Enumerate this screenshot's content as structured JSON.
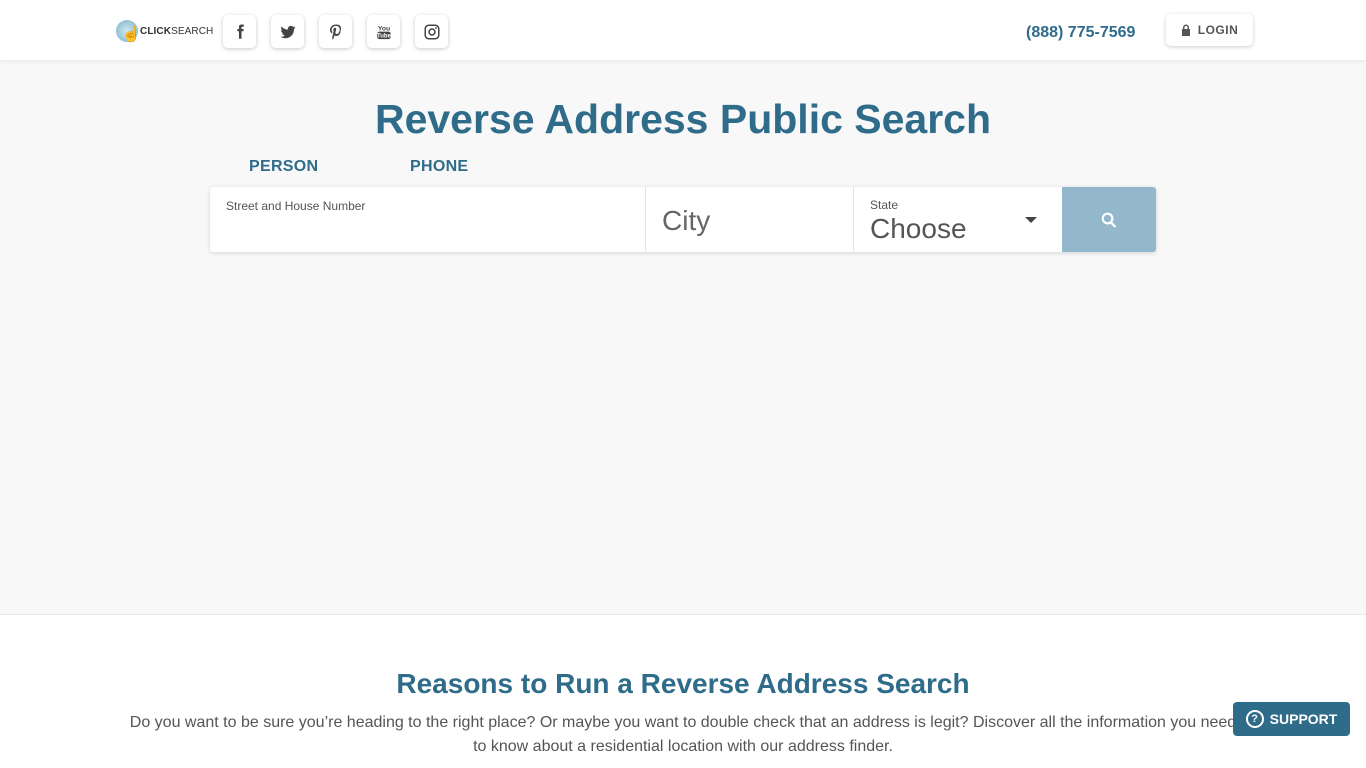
{
  "header": {
    "logo": {
      "prefix": "CLICK",
      "suffix": "SEARCH"
    },
    "socials": [
      {
        "icon": "facebook-icon"
      },
      {
        "icon": "twitter-icon"
      },
      {
        "icon": "pinterest-icon"
      },
      {
        "icon": "youtube-icon"
      },
      {
        "icon": "instagram-icon"
      }
    ],
    "phone": "(888) 775-7569",
    "login_label": "LOGIN"
  },
  "hero": {
    "title": "Reverse Address Public Search",
    "tabs": [
      {
        "label": "PERSON"
      },
      {
        "label": "PHONE"
      }
    ]
  },
  "search": {
    "street_label": "Street and House Number",
    "street_value": "",
    "city_placeholder": "City",
    "state_label": "State",
    "state_value": "Choose"
  },
  "reasons": {
    "title": "Reasons to Run a Reverse Address Search",
    "text": "Do you want to be sure you’re heading to the right place? Or maybe you want to double check that an address is legit? Discover all the information you need to know about a residential location with our address finder."
  },
  "support_label": "SUPPORT",
  "colors": {
    "accent": "#2e6c8a",
    "search_button": "#93b8cc",
    "background": "#f8f8f8"
  }
}
